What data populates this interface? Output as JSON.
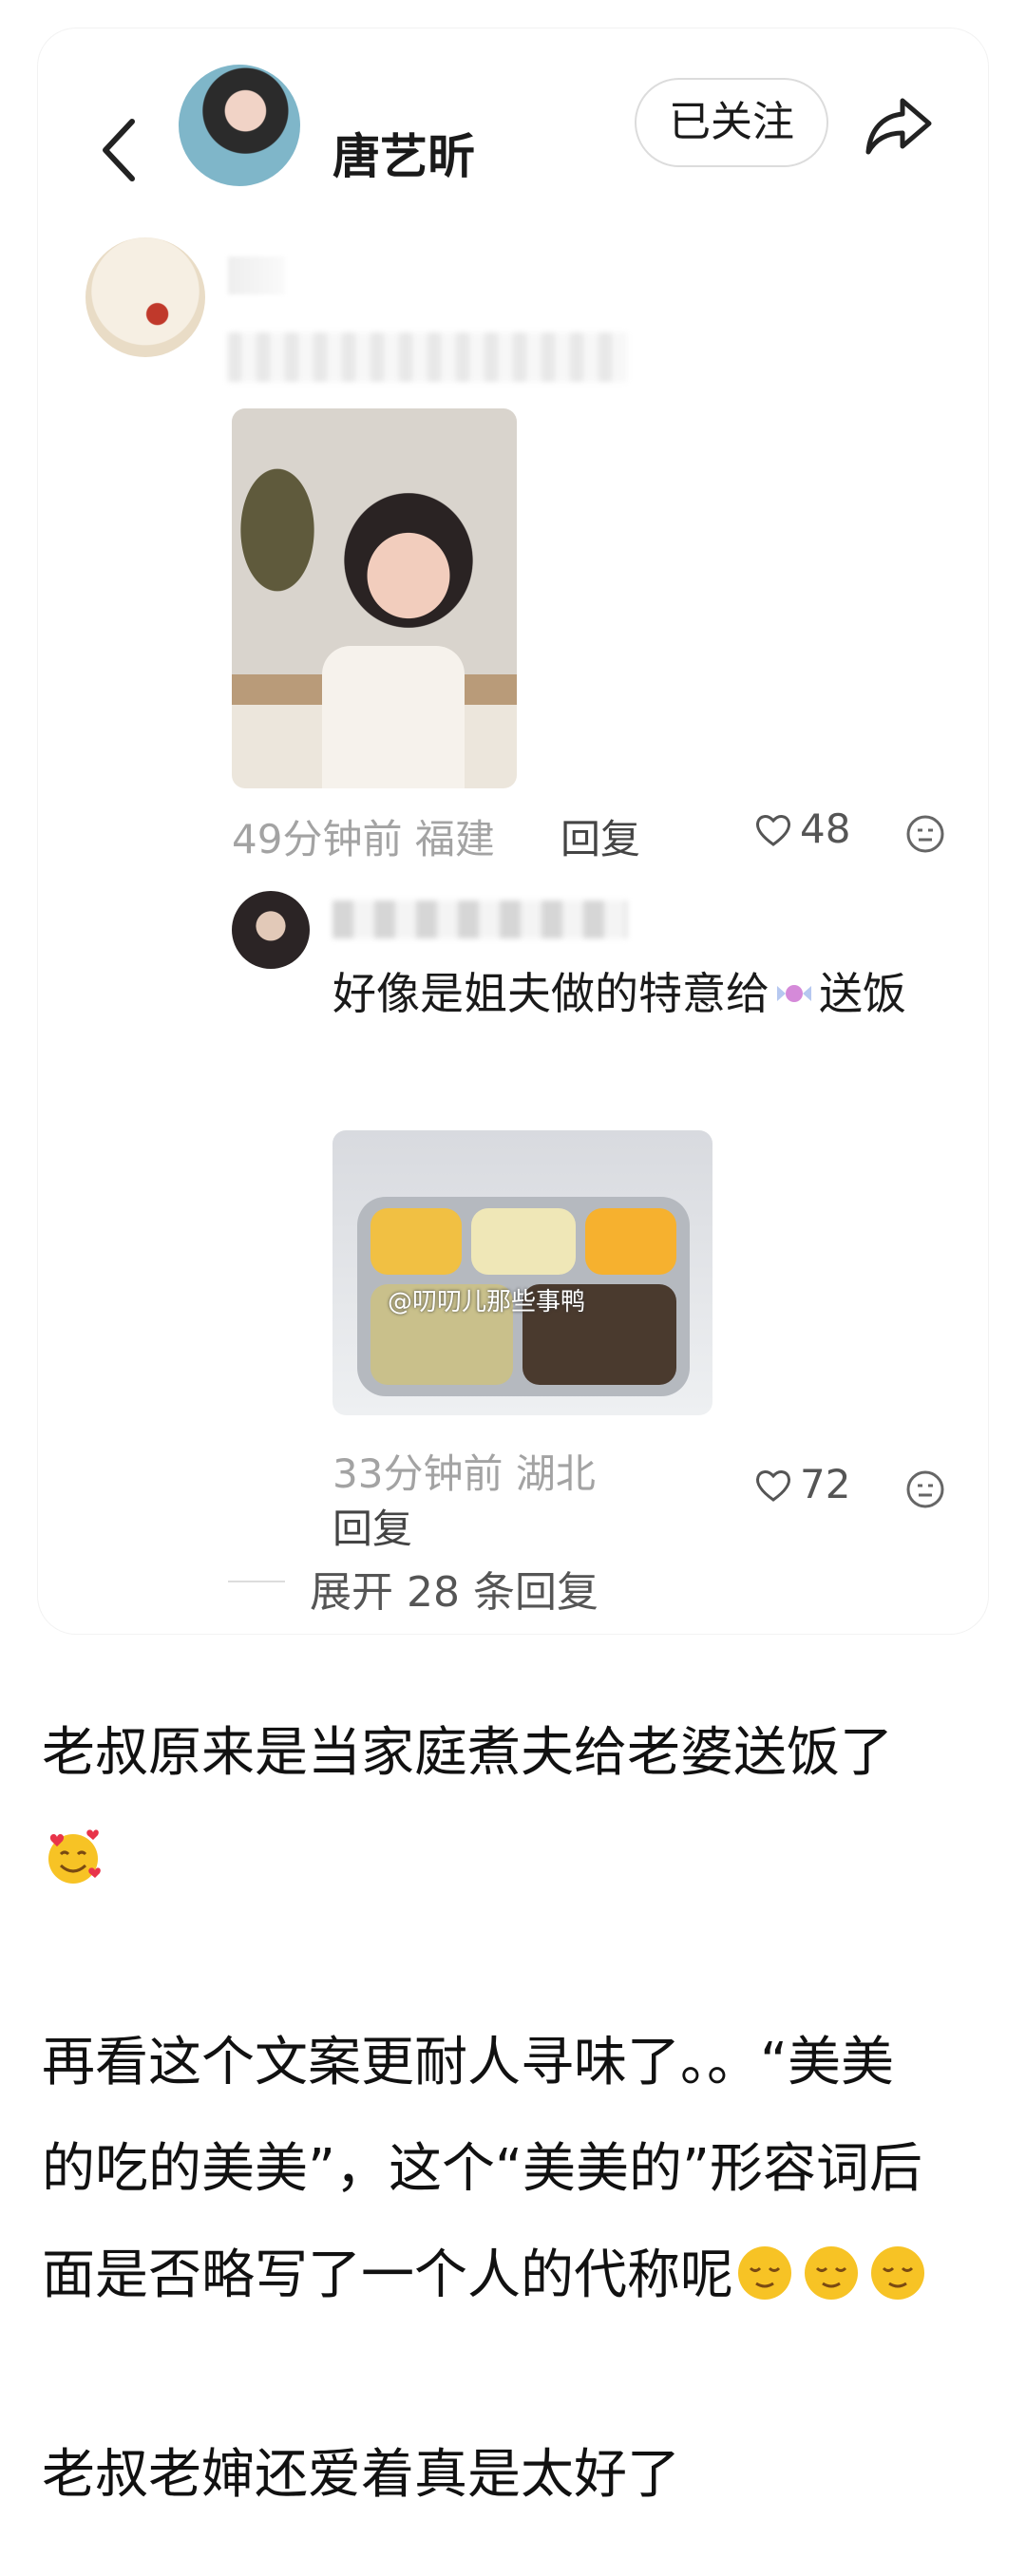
{
  "header": {
    "username": "唐艺昕",
    "follow_label": "已关注"
  },
  "comment": {
    "time": "49分钟前",
    "location": "福建",
    "reply_label": "回复",
    "likes": "48"
  },
  "reply": {
    "text": "好像是姐夫做的特意给",
    "text_end": "送饭",
    "image_watermark": "@叨叨儿那些事鸭",
    "time": "33分钟前",
    "location": "湖北",
    "reply_label": "回复",
    "likes": "72"
  },
  "expand_label": "展开 28 条回复",
  "article": {
    "p1": "老叔原来是当家庭煮夫给老婆送饭了",
    "p2_l1": "再看这个文案更耐人寻味了。。“美美",
    "p2_l2": "的吃的美美”，这个“美美的”形容词后",
    "p2_l3": "面是否略写了一个人的代称呢",
    "p3": "老叔老婶还爱着真是太好了"
  },
  "icons": {
    "back": "chevron-left-icon",
    "share": "share-icon",
    "like": "heart-outline-icon",
    "dislike": "meh-face-icon",
    "heart_eyes": "smiling-face-with-hearts-emoji",
    "relieved": "relieved-face-emoji"
  }
}
